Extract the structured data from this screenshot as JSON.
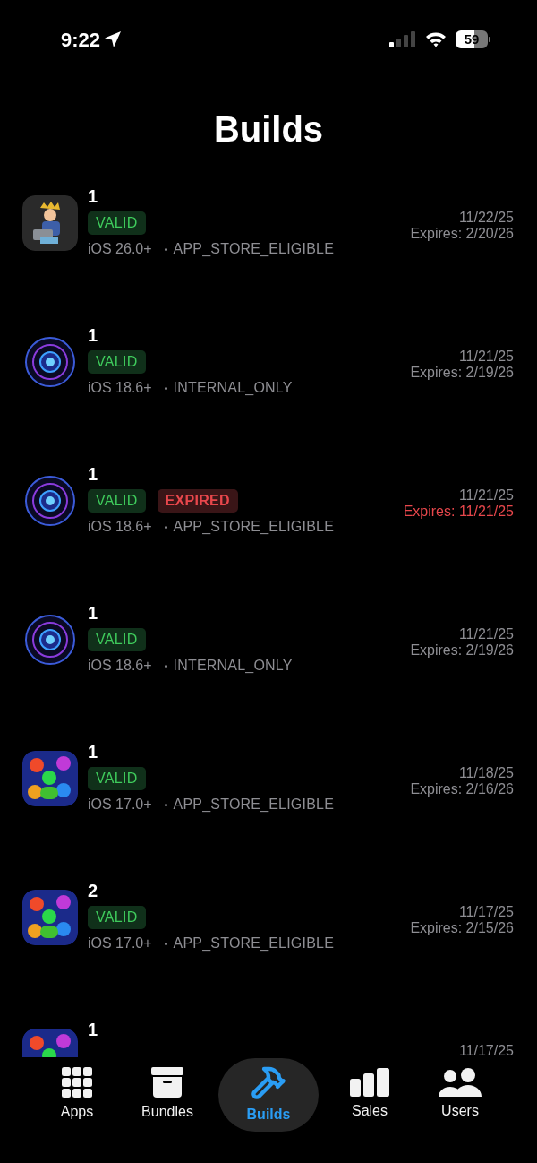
{
  "status_bar": {
    "time": "9:22",
    "battery": "59"
  },
  "title": "Builds",
  "builds": [
    {
      "kind": "printer",
      "number": "1",
      "badges": [
        {
          "kind": "valid",
          "label": "VALID"
        }
      ],
      "os": "iOS 26.0+",
      "distribution": "APP_STORE_ELIGIBLE",
      "date": "11/22/25",
      "expires": "Expires: 2/20/26",
      "expired": false
    },
    {
      "kind": "radar",
      "number": "1",
      "badges": [
        {
          "kind": "valid",
          "label": "VALID"
        }
      ],
      "os": "iOS 18.6+",
      "distribution": "INTERNAL_ONLY",
      "date": "11/21/25",
      "expires": "Expires: 2/19/26",
      "expired": false
    },
    {
      "kind": "radar",
      "number": "1",
      "badges": [
        {
          "kind": "valid",
          "label": "VALID"
        },
        {
          "kind": "expired",
          "label": "EXPIRED"
        }
      ],
      "os": "iOS 18.6+",
      "distribution": "APP_STORE_ELIGIBLE",
      "date": "11/21/25",
      "expires": "Expires: 11/21/25",
      "expired": true
    },
    {
      "kind": "radar",
      "number": "1",
      "badges": [
        {
          "kind": "valid",
          "label": "VALID"
        }
      ],
      "os": "iOS 18.6+",
      "distribution": "INTERNAL_ONLY",
      "date": "11/21/25",
      "expires": "Expires: 2/19/26",
      "expired": false
    },
    {
      "kind": "people",
      "number": "1",
      "badges": [
        {
          "kind": "valid",
          "label": "VALID"
        }
      ],
      "os": "iOS 17.0+",
      "distribution": "APP_STORE_ELIGIBLE",
      "date": "11/18/25",
      "expires": "Expires: 2/16/26",
      "expired": false
    },
    {
      "kind": "people",
      "number": "2",
      "badges": [
        {
          "kind": "valid",
          "label": "VALID"
        }
      ],
      "os": "iOS 17.0+",
      "distribution": "APP_STORE_ELIGIBLE",
      "date": "11/17/25",
      "expires": "Expires: 2/15/26",
      "expired": false
    },
    {
      "kind": "people",
      "number": "1",
      "date": "11/17/25"
    }
  ],
  "tabs": [
    {
      "kind": "grid",
      "label": "Apps",
      "selected": false
    },
    {
      "kind": "box",
      "label": "Bundles",
      "selected": false
    },
    {
      "kind": "hammer",
      "label": "Builds",
      "selected": true
    },
    {
      "kind": "bars",
      "label": "Sales",
      "selected": false
    },
    {
      "kind": "people",
      "label": "Users",
      "selected": false
    }
  ]
}
